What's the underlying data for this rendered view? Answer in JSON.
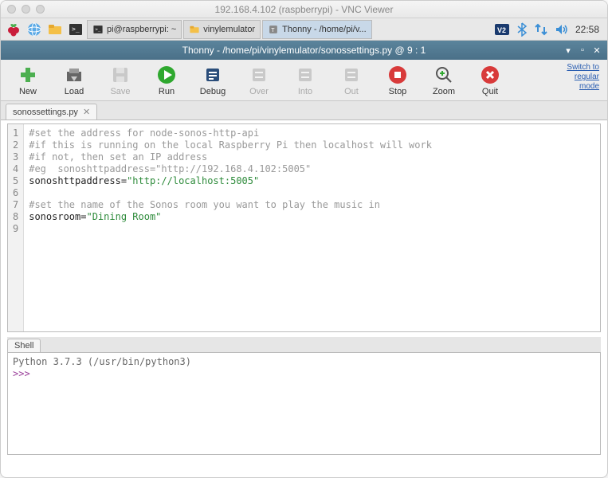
{
  "mac": {
    "title": "192.168.4.102 (raspberrypi) - VNC Viewer"
  },
  "taskbar": {
    "tasks": [
      {
        "label": "pi@raspberrypi: ~"
      },
      {
        "label": "vinylemulator"
      },
      {
        "label": "Thonny  -  /home/pi/v..."
      }
    ],
    "clock": "22:58"
  },
  "thonny": {
    "title": "Thonny  -  /home/pi/vinylemulator/sonossettings.py  @  9 : 1",
    "switch_link_l1": "Switch to",
    "switch_link_l2": "regular",
    "switch_link_l3": "mode",
    "toolbar": {
      "new": "New",
      "load": "Load",
      "save": "Save",
      "run": "Run",
      "debug": "Debug",
      "over": "Over",
      "into": "Into",
      "out": "Out",
      "stop": "Stop",
      "zoom": "Zoom",
      "quit": "Quit"
    },
    "tab": {
      "name": "sonossettings.py"
    },
    "code": {
      "lines": [
        "1",
        "2",
        "3",
        "4",
        "5",
        "6",
        "7",
        "8",
        "9"
      ],
      "l1": "#set the address for node-sonos-http-api",
      "l2": "#if this is running on the local Raspberry Pi then localhost will work",
      "l3": "#if not, then set an IP address",
      "l4": "#eg  sonoshttpaddress=\"http://192.168.4.102:5005\"",
      "l5a": "sonoshttpaddress=",
      "l5b": "\"http://localhost:5005\"",
      "l7": "#set the name of the Sonos room you want to play the music in",
      "l8a": "sonosroom=",
      "l8b": "\"Dining Room\""
    },
    "shell": {
      "tab": "Shell",
      "line1": "Python 3.7.3 (/usr/bin/python3)",
      "prompt": ">>> "
    }
  }
}
